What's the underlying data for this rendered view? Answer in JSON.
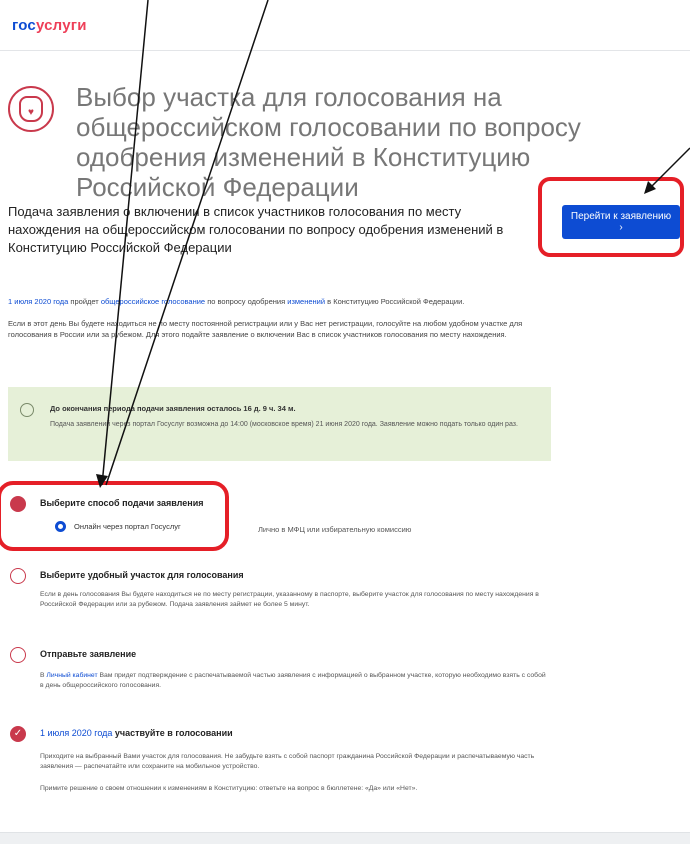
{
  "header": {
    "logo_part1": "гос",
    "logo_part2": "услуги"
  },
  "page_title": "Выбор участка для голосования на общероссийском голосовании по вопросу одобрения изменений в Конституцию Российской Федерации",
  "subtitle": "Подача заявления о включении в список участников голосования по месту нахождения на общероссийском голосовании по вопросу одобрения изменений в Конституцию Российской Федерации",
  "cta_label": "Перейти к заявлению ›",
  "intro": {
    "line1_date": "1 июля 2020 года",
    "line1_mid": " пройдет ",
    "line1_link": "общероссийское голосование",
    "line1_mid2": " по вопросу одобрения ",
    "line1_link2": "изменений",
    "line1_end": " в Конституцию Российской Федерации.",
    "line2": "Если в этот день Вы будете находиться не по месту постоянной регистрации или у Вас нет регистрации, голосуйте на любом удобном участке для голосования в России или за рубежом. Для этого подайте заявление о включении Вас в список участников голосования по месту нахождения."
  },
  "notice": {
    "title": "До окончания периода подачи заявления осталось 16 д. 9 ч. 34 м.",
    "text": "Подача заявлений через портал Госуслуг возможна до 14:00 (московское время) 21 июня 2020 года. Заявление можно подать только один раз."
  },
  "steps": [
    {
      "title": "Выберите способ подачи заявления"
    },
    {
      "title": "Выберите удобный участок для голосования",
      "text": "Если в день голосования Вы будете находиться не по месту регистрации, указанному в паспорте, выберите участок для голосования по месту нахождения в Российской Федерации или за рубежом. Подача заявления займет не более 5 минут."
    },
    {
      "title": "Отправьте заявление",
      "text_link": "Личный кабинет",
      "text": " Вам придет подтверждение с распечатываемой частью заявления с информацией о выбранном участке, которую необходимо взять с собой в день общероссийского голосования.",
      "text_prefix": "В "
    },
    {
      "title_accent": "1 июля 2020 года",
      "title": " участвуйте в голосовании",
      "text1": "Приходите на выбранный Вами участок для голосования. Не забудьте взять с собой паспорт гражданина Российской Федерации и распечатываемую часть заявления — распечатайте или сохраните на мобильное устройство.",
      "text2": "Примите решение о своем отношении к изменениям в Конституцию: ответьте на вопрос в бюллетене: «Да» или «Нет»."
    }
  ],
  "options": {
    "online": "Онлайн через портал Госуслуг",
    "offline": "Лично в МФЦ или избирательную комиссию"
  },
  "colors": {
    "brand_blue": "#0d4cd3",
    "brand_red": "#ee3f58",
    "highlight": "#e51f27",
    "notice_bg": "#e6f0d8"
  }
}
